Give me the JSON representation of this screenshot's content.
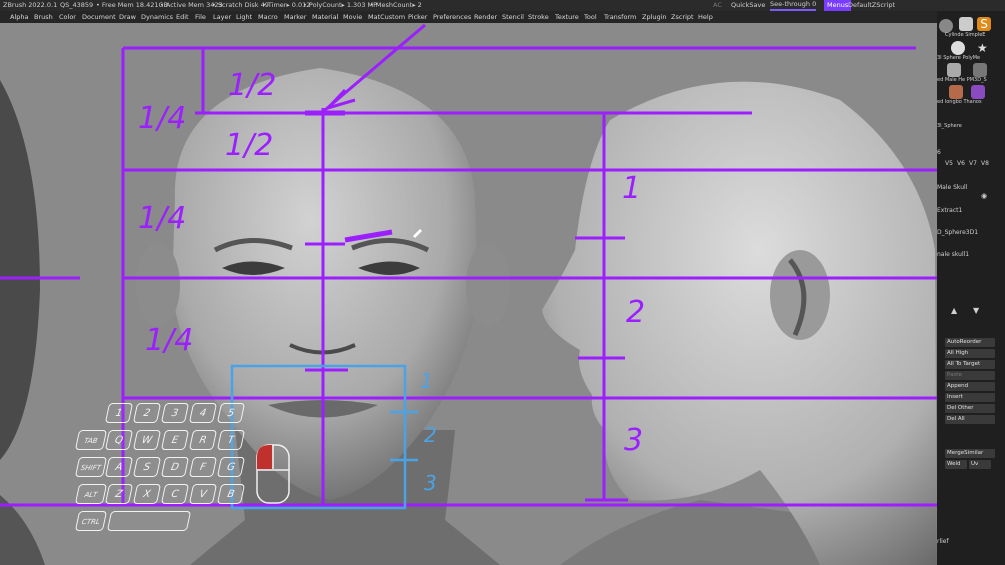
{
  "titlebar": {
    "app": "ZBrush 2022.0.1",
    "session": "QS_43859",
    "free_mem": "• Free Mem 18.421GB",
    "active_mem": "• Active Mem 3423",
    "scratch_disk": "• Scratch Disk 49",
    "timer": "• Timer▸ 0.012",
    "polycount": "• PolyCount▸ 1.303 MP",
    "meshcount": "• MeshCount▸ 2",
    "ac": "AC",
    "quicksave": "QuickSave",
    "see_through": "See-through  0",
    "menus": "Menus",
    "zscript": "DefaultZScript"
  },
  "menubar": {
    "items": [
      "Alpha",
      "Brush",
      "Color",
      "Document",
      "Draw",
      "Dynamics",
      "Edit",
      "File",
      "Layer",
      "Light",
      "Macro",
      "Marker",
      "Material",
      "Movie",
      "MatCustom",
      "Picker",
      "Preferences",
      "Render",
      "Stencil",
      "Stroke",
      "Texture",
      "Tool",
      "Transform",
      "Zplugin",
      "Zscript",
      "Help"
    ]
  },
  "rightpanel": {
    "subtools": [
      "Cylinde SimpleE",
      "3I Sphere PolyMe",
      "ed Male He PM3D_S",
      "ed longbo Thanos"
    ],
    "sphere_label": "3I_Sphere",
    "level_row": "6",
    "versions": [
      "V5",
      "V6",
      "V7",
      "V8"
    ],
    "layers": [
      "Male Skull",
      "Extract1",
      "D_Sphere3D1",
      "nale skull1"
    ],
    "buttons": [
      "AutoReorder",
      "All High",
      "All To Target",
      "Paste",
      "Append",
      "Insert",
      "Del Other",
      "Del All"
    ],
    "merge": "MergeSimilar",
    "weld": "Weld",
    "uv": "Uv",
    "bottom": "rlief"
  },
  "viewport": {
    "annotations": [
      "1/2",
      "1/2",
      "1/4",
      "1/4",
      "1/4",
      "1",
      "2",
      "3",
      "1",
      "2",
      "3"
    ],
    "accent": "#9b1fff",
    "guide_blue": "#4aa3e6"
  },
  "keypad": {
    "numbers": [
      "1",
      "2",
      "3",
      "4",
      "5"
    ],
    "row_tab": [
      "TAB",
      "Q",
      "W",
      "E",
      "R",
      "T"
    ],
    "row_shift": [
      "SHIFT",
      "A",
      "S",
      "D",
      "F",
      "G"
    ],
    "row_alt": [
      "ALT",
      "Z",
      "X",
      "C",
      "V",
      "B"
    ],
    "row_ctrl": [
      "CTRL"
    ]
  }
}
